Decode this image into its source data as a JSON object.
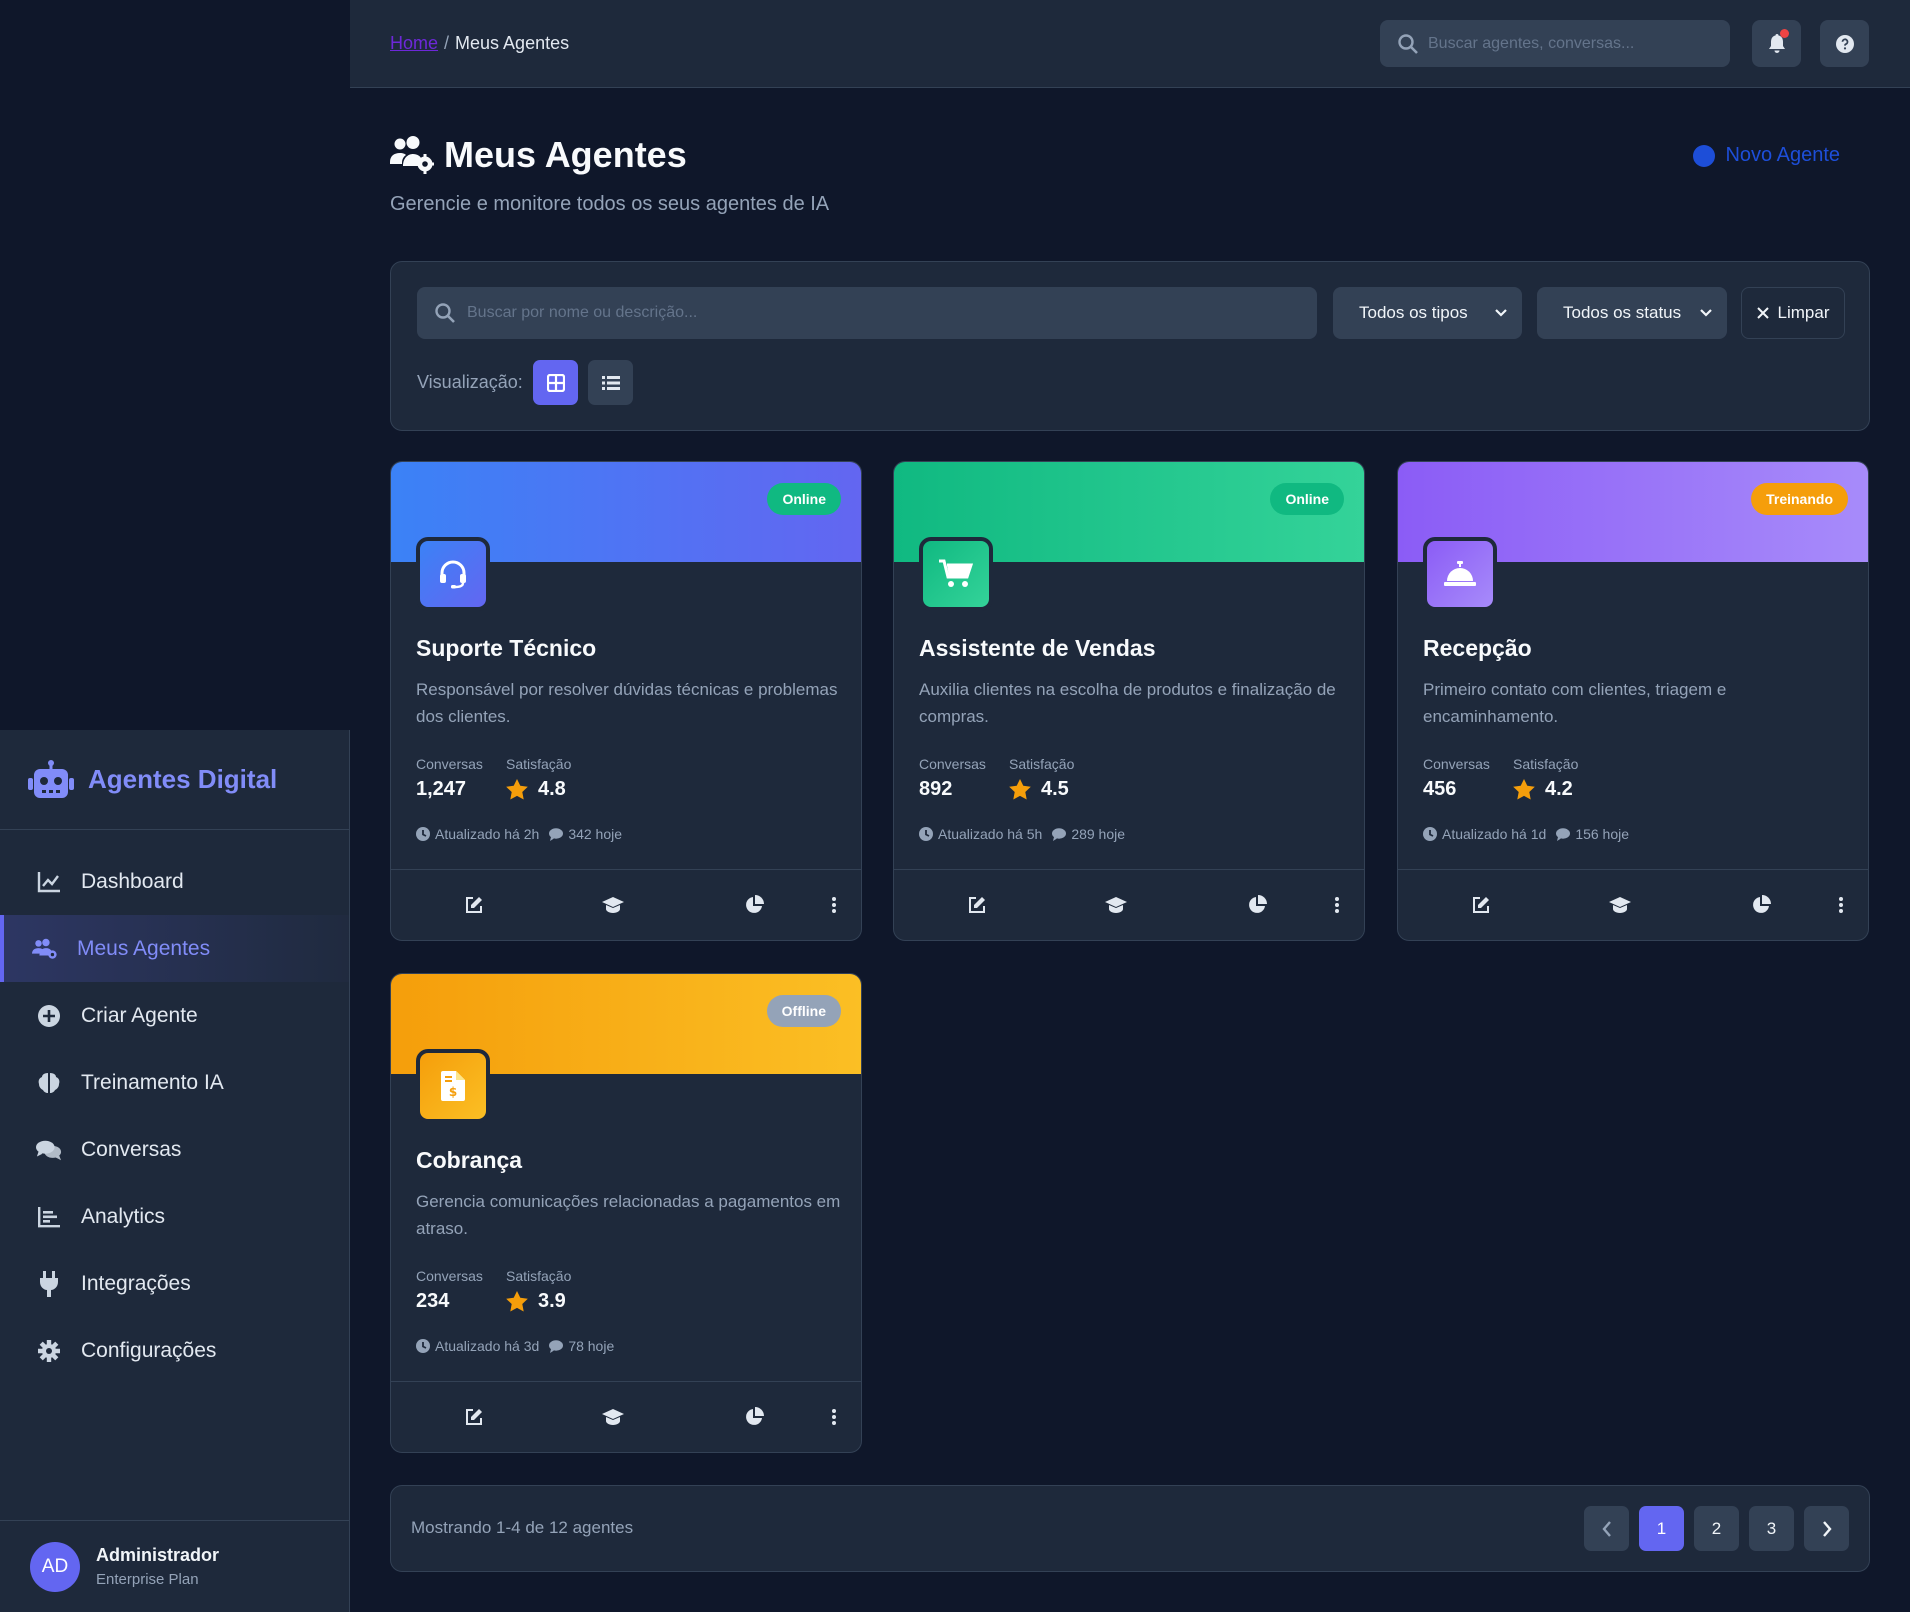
{
  "brand": {
    "name": "Agentes Digital"
  },
  "sidebar": {
    "items": [
      {
        "label": "Dashboard",
        "icon": "chart-line-icon"
      },
      {
        "label": "Meus Agentes",
        "icon": "users-gear-icon",
        "active": true
      },
      {
        "label": "Criar Agente",
        "icon": "plus-circle-icon"
      },
      {
        "label": "Treinamento IA",
        "icon": "brain-icon"
      },
      {
        "label": "Conversas",
        "icon": "comments-icon"
      },
      {
        "label": "Analytics",
        "icon": "bar-chart-icon"
      },
      {
        "label": "Integrações",
        "icon": "plug-icon"
      },
      {
        "label": "Configurações",
        "icon": "gear-icon"
      }
    ]
  },
  "user": {
    "initials": "AD",
    "name": "Administrador",
    "plan": "Enterprise Plan"
  },
  "header": {
    "breadcrumb_home": "Home",
    "breadcrumb_sep": "/",
    "breadcrumb_current": "Meus Agentes",
    "search_placeholder": "Buscar agentes, conversas..."
  },
  "page": {
    "title": "Meus Agentes",
    "subtitle": "Gerencie e monitore todos os seus agentes de IA",
    "new_agent_label": "Novo Agente"
  },
  "filters": {
    "search_placeholder": "Buscar por nome ou descrição...",
    "type_select": "Todos os tipos",
    "status_select": "Todos os status",
    "clear_label": "Limpar",
    "view_label": "Visualização:"
  },
  "stats_labels": {
    "conversations": "Conversas",
    "satisfaction": "Satisfação"
  },
  "agents": [
    {
      "name": "Suporte Técnico",
      "description": "Responsável por resolver dúvidas técnicas e problemas dos clientes.",
      "status": "Online",
      "conversations": "1,247",
      "rating": "4.8",
      "updated": "Atualizado há 2h",
      "today": "342 hoje",
      "icon": "headset-icon",
      "colors": {
        "from": "#3b82f6",
        "to": "#6366f1",
        "status_bg": "#10b981"
      }
    },
    {
      "name": "Assistente de Vendas",
      "description": "Auxilia clientes na escolha de produtos e finalização de compras.",
      "status": "Online",
      "conversations": "892",
      "rating": "4.5",
      "updated": "Atualizado há 5h",
      "today": "289 hoje",
      "icon": "cart-icon",
      "colors": {
        "from": "#10b981",
        "to": "#34d399",
        "status_bg": "#10b981"
      }
    },
    {
      "name": "Recepção",
      "description": "Primeiro contato com clientes, triagem e encaminhamento.",
      "status": "Treinando",
      "conversations": "456",
      "rating": "4.2",
      "updated": "Atualizado há 1d",
      "today": "156 hoje",
      "icon": "bell-concierge-icon",
      "colors": {
        "from": "#8b5cf6",
        "to": "#a78bfa",
        "status_bg": "#f59e0b"
      }
    },
    {
      "name": "Cobrança",
      "description": "Gerencia comunicações relacionadas a pagamentos em atraso.",
      "status": "Offline",
      "conversations": "234",
      "rating": "3.9",
      "updated": "Atualizado há 3d",
      "today": "78 hoje",
      "icon": "invoice-dollar-icon",
      "colors": {
        "from": "#f59e0b",
        "to": "#fbbf24",
        "status_bg": "#94a3b8"
      }
    }
  ],
  "pagination": {
    "summary": "Mostrando 1-4 de 12 agentes",
    "pages": [
      "1",
      "2",
      "3"
    ],
    "current": "1"
  }
}
